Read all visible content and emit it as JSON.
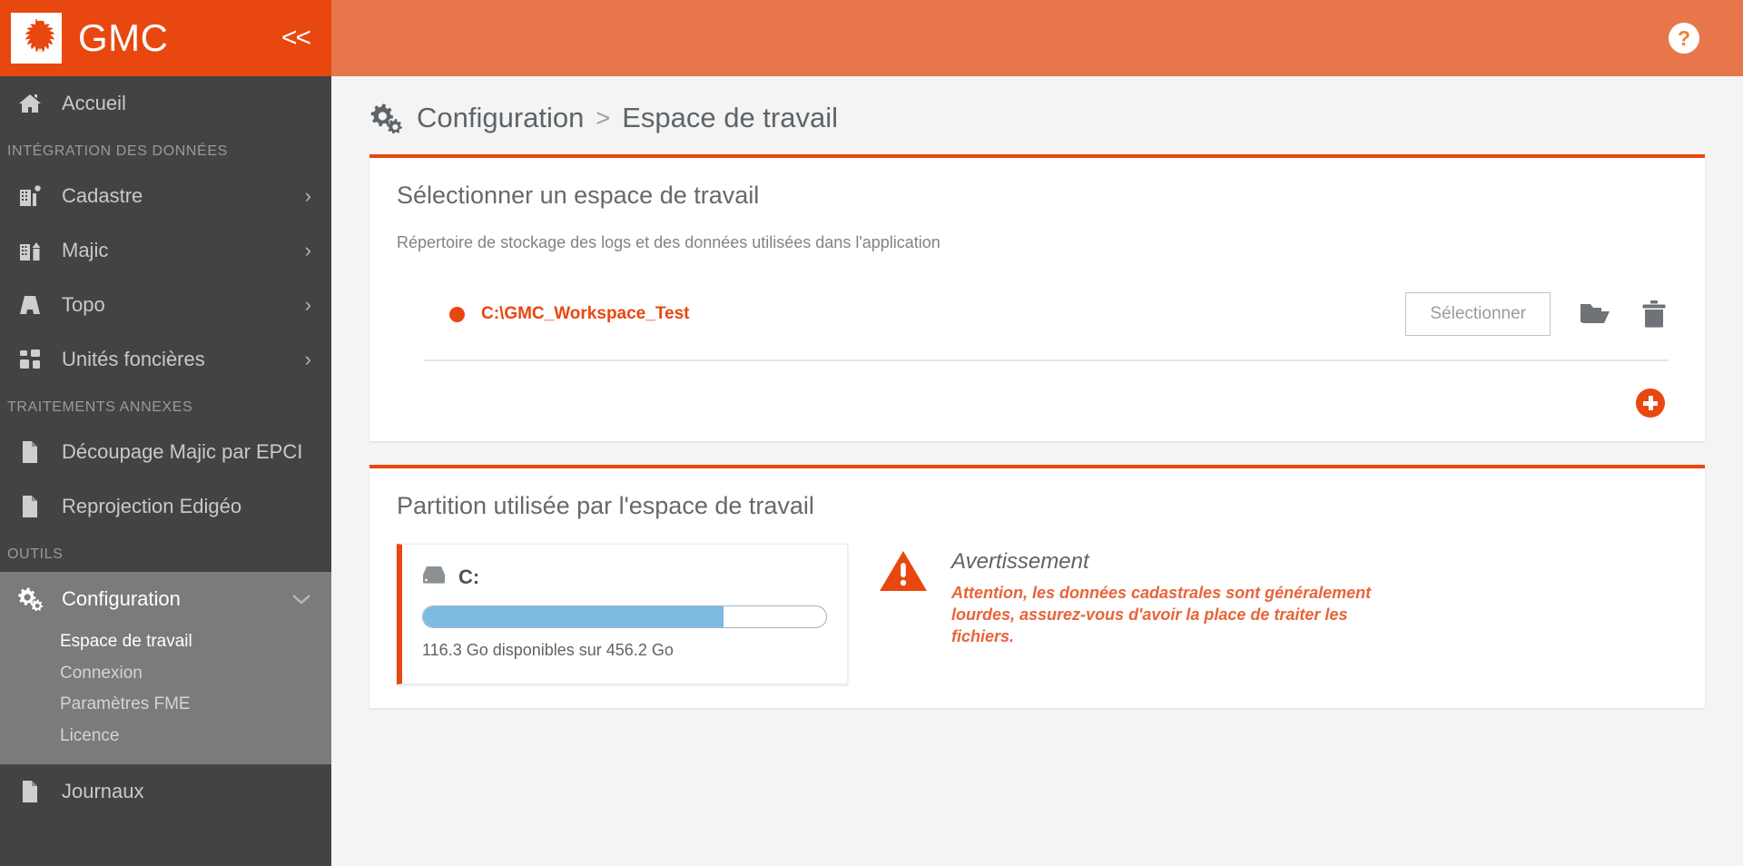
{
  "brand": {
    "title": "GMC",
    "logo_icon": "grape-leaf-logo",
    "collapse_icon": "double-chevron-left",
    "collapse_label": "<<"
  },
  "topbar": {
    "help_icon": "question-mark-help-icon",
    "help_label": "?"
  },
  "sidebar": {
    "home": {
      "label": "Accueil",
      "icon": "home-icon"
    },
    "sections": [
      {
        "title": "INTÉGRATION DES DONNÉES",
        "items": [
          {
            "label": "Cadastre",
            "icon": "building-pin-icon",
            "chevron": "chevron-right-icon",
            "chevron_label": "›"
          },
          {
            "label": "Majic",
            "icon": "building-roof-icon",
            "chevron": "chevron-right-icon",
            "chevron_label": "›"
          },
          {
            "label": "Topo",
            "icon": "road-icon",
            "chevron": "chevron-right-icon",
            "chevron_label": "›"
          },
          {
            "label": "Unités foncières",
            "icon": "grid-squares-icon",
            "chevron": "chevron-right-icon",
            "chevron_label": "›"
          }
        ]
      },
      {
        "title": "TRAITEMENTS ANNEXES",
        "items": [
          {
            "label": "Découpage Majic par EPCI",
            "icon": "file-icon",
            "chevron": "",
            "chevron_label": ""
          },
          {
            "label": "Reprojection Edigéo",
            "icon": "file-icon",
            "chevron": "",
            "chevron_label": ""
          }
        ]
      },
      {
        "title": "OUTILS",
        "items": []
      }
    ],
    "configuration": {
      "label": "Configuration",
      "icon": "gears-icon",
      "chevron": "chevron-down-icon",
      "chevron_label": "⌄",
      "subitems": [
        {
          "label": "Espace de travail",
          "selected": true
        },
        {
          "label": "Connexion",
          "selected": false
        },
        {
          "label": "Paramètres FME",
          "selected": false
        },
        {
          "label": "Licence",
          "selected": false
        }
      ]
    },
    "journaux": {
      "label": "Journaux",
      "icon": "file-icon"
    }
  },
  "breadcrumb": {
    "icon": "gears-icon",
    "parent": "Configuration",
    "separator": ">",
    "current": "Espace de travail"
  },
  "workspace_card": {
    "title": "Sélectionner un espace de travail",
    "subtitle": "Répertoire de stockage des logs et des données utilisées dans l'application",
    "entries": [
      {
        "path": "C:\\GMC_Workspace_Test",
        "select_label": "Sélectionner",
        "browse_icon": "folder-open-icon",
        "delete_icon": "trash-icon",
        "status_color": "#e8470f"
      }
    ],
    "add_icon": "plus-circle-icon",
    "accent_color": "#e8470f"
  },
  "partition_card": {
    "title": "Partition utilisée par l'espace de travail",
    "disk": {
      "icon": "hard-drive-icon",
      "label": "C:",
      "caption": "116.3 Go disponibles sur 456.2 Go",
      "available_go": 116.3,
      "total_go": 456.2,
      "used_percent": 74.5,
      "fill_color": "#7dbbe3"
    },
    "warning": {
      "icon": "warning-triangle-icon",
      "title": "Avertissement",
      "message": "Attention, les données cadastrales sont généralement lourdes, assurez-vous d'avoir la place de traiter les fichiers.",
      "color": "#e8643a"
    }
  }
}
